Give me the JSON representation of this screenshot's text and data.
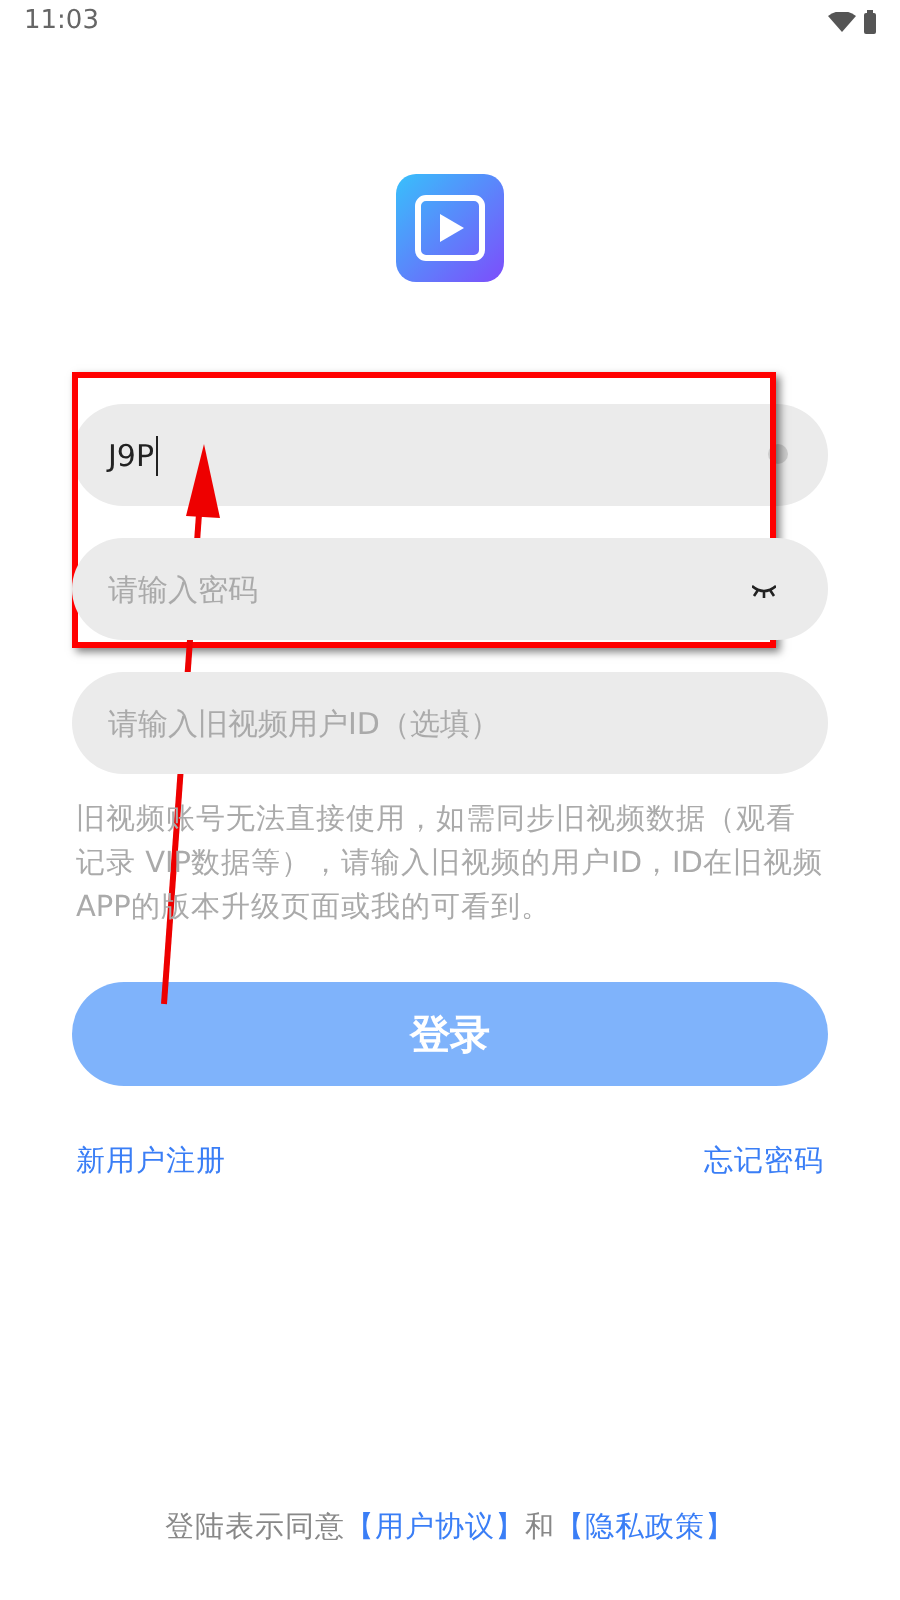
{
  "status_bar": {
    "time": "11:03"
  },
  "fields": [
    {
      "kind": "text",
      "value": "J9P",
      "focused": true
    },
    {
      "kind": "password",
      "placeholder": "请输入密码",
      "focused": false
    },
    {
      "kind": "text",
      "placeholder": "请输入旧视频用户ID（选填）",
      "focused": false
    }
  ],
  "note": "旧视频账号无法直接使用，如需同步旧视频数据（观看记录 VIP数据等），请输入旧视频的用户ID，ID在旧视频APP的版本升级页面或我的可看到。",
  "login_button": {
    "label": "登录",
    "disabled": true
  },
  "links": {
    "register": "新用户注册",
    "forgot": "忘记密码"
  },
  "footer": {
    "prefix": "登陆表示同意",
    "agreement": "【用户协议】",
    "and": "和",
    "privacy": "【隐私政策】"
  }
}
